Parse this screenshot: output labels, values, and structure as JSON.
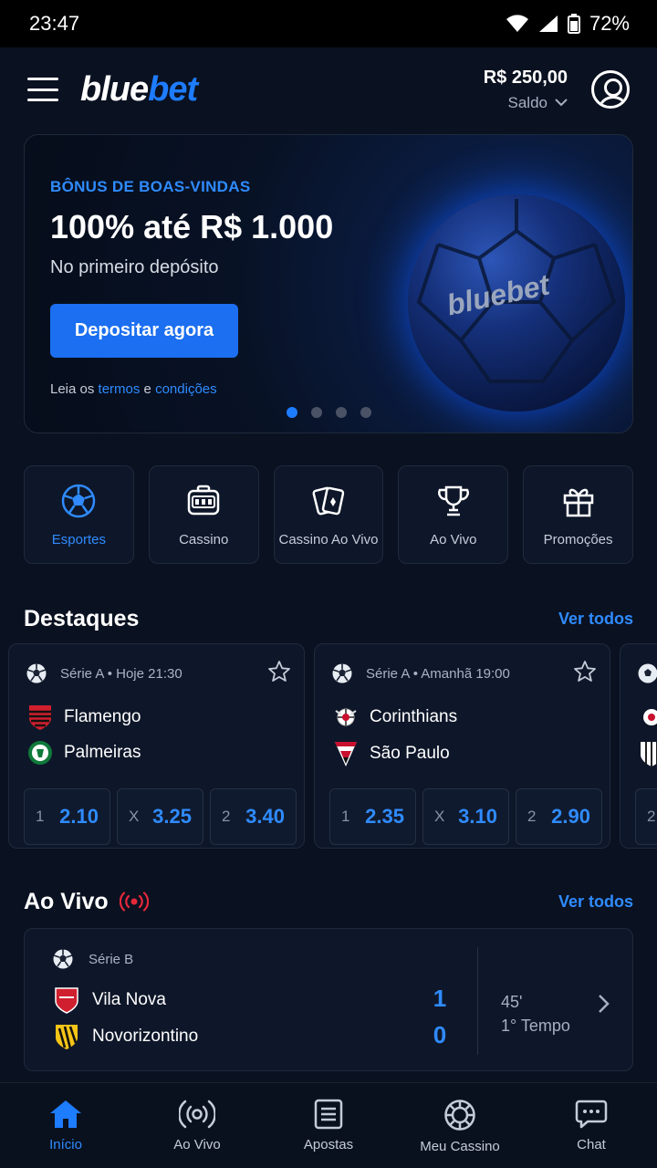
{
  "status_bar": {
    "time": "23:47",
    "battery": "72%"
  },
  "header": {
    "logo_part1": "blue",
    "logo_part2": "bet",
    "balance": "R$ 250,00",
    "balance_label": "Saldo"
  },
  "banner": {
    "eyebrow": "BÔNUS DE BOAS-VINDAS",
    "title": "100% até R$ 1.000",
    "subtitle": "No primeiro depósito",
    "cta": "Depositar agora",
    "terms_prefix": "Leia os ",
    "terms_link": "termos",
    "terms_mid": " e ",
    "conditions_link": "condições",
    "ball_text": "bluebet",
    "slides": 4,
    "active_slide": 1
  },
  "categories": [
    {
      "label": "Esportes",
      "icon": "soccer-ball-icon",
      "active": true
    },
    {
      "label": "Cassino",
      "icon": "slot-machine-icon",
      "active": false
    },
    {
      "label": "Cassino Ao Vivo",
      "icon": "cards-icon",
      "active": false
    },
    {
      "label": "Ao Vivo",
      "icon": "trophy-icon",
      "active": false
    },
    {
      "label": "Promoções",
      "icon": "gift-icon",
      "active": false
    }
  ],
  "highlights": {
    "title": "Destaques",
    "link": "Ver todos",
    "matches": [
      {
        "meta": "Série A • Hoje 21:30",
        "home": "Flamengo",
        "away": "Palmeiras",
        "odds": [
          {
            "key": "1",
            "value": "2.10"
          },
          {
            "key": "X",
            "value": "3.25"
          },
          {
            "key": "2",
            "value": "3.40"
          }
        ]
      },
      {
        "meta": "Série A • Amanhã 19:00",
        "home": "Corinthians",
        "away": "São Paulo",
        "odds": [
          {
            "key": "1",
            "value": "2.35"
          },
          {
            "key": "X",
            "value": "3.10"
          },
          {
            "key": "2",
            "value": "2.90"
          }
        ]
      },
      {
        "odds": [
          {
            "key": "2"
          }
        ]
      }
    ]
  },
  "live": {
    "title": "Ao Vivo",
    "link": "Ver todos",
    "match": {
      "league": "Série B",
      "home": "Vila Nova",
      "away": "Novorizontino",
      "home_score": "1",
      "away_score": "0",
      "minute": "45'",
      "period": "1° Tempo"
    }
  },
  "bottom_nav": [
    {
      "label": "Início",
      "icon": "home-icon",
      "active": true
    },
    {
      "label": "Ao Vivo",
      "icon": "live-broadcast-icon",
      "active": false
    },
    {
      "label": "Apostas",
      "icon": "betslip-icon",
      "active": false
    },
    {
      "label": "Meu Cassino",
      "icon": "casino-chip-icon",
      "active": false
    },
    {
      "label": "Chat",
      "icon": "chat-icon",
      "active": false
    }
  ],
  "colors": {
    "accent": "#1e7cff",
    "background": "#0a1120",
    "card": "#0e1729",
    "live_red": "#e5283a"
  }
}
